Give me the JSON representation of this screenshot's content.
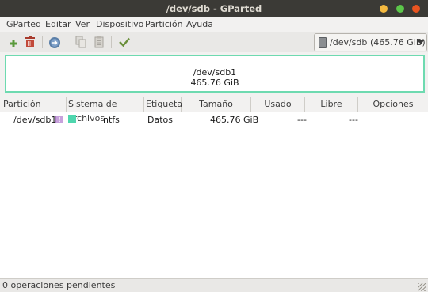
{
  "window": {
    "title": "/dev/sdb - GParted",
    "controls": {
      "minimize_color": "#f4b93f",
      "maximize_color": "#5cc74a",
      "close_color": "#e95420"
    }
  },
  "menu": [
    "GParted",
    "Editar",
    "Ver",
    "Dispositivo",
    "Partición",
    "Ayuda"
  ],
  "toolbar": {
    "icons": [
      "add-icon",
      "delete-icon",
      "resize-icon",
      "copy-icon",
      "paste-icon",
      "apply-icon"
    ],
    "device": "/dev/sdb",
    "device_size": "(465.76 GiB)"
  },
  "map": {
    "partition": "/dev/sdb1",
    "size": "465.76 GiB",
    "border_color": "#6edab0"
  },
  "table": {
    "headers": [
      "Partición",
      "Sistema de archivos",
      "Etiqueta",
      "Tamaño",
      "Usado",
      "Libre",
      "Opciones"
    ],
    "rows": [
      {
        "partition": "/dev/sdb1",
        "filesystem": "ntfs",
        "label": "Datos",
        "size": "465.76 GiB",
        "used": "---",
        "free": "---",
        "options": "",
        "fs_color": "#4fd6ae"
      }
    ]
  },
  "status": {
    "pending": "0 operaciones pendientes"
  }
}
